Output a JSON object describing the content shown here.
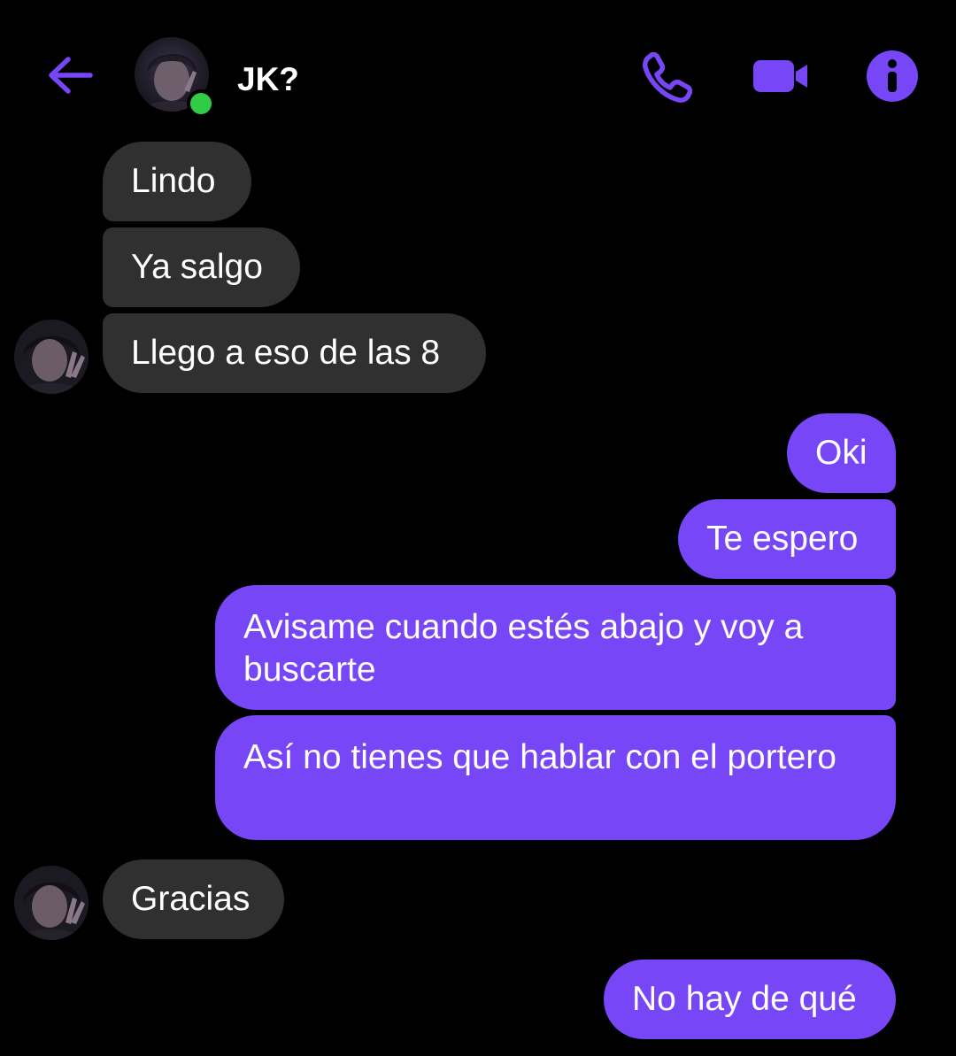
{
  "header": {
    "contact_name": "JK?",
    "online": true,
    "actions": [
      {
        "name": "phone-call",
        "icon": "phone-icon"
      },
      {
        "name": "video-call",
        "icon": "video-camera-icon"
      },
      {
        "name": "conversation-info",
        "icon": "info-icon"
      }
    ]
  },
  "colors": {
    "background": "#000000",
    "accent": "#7646f7",
    "incoming_bubble": "#303030",
    "online_indicator": "#31cc46"
  },
  "messages": [
    {
      "direction": "incoming",
      "text": "Lindo"
    },
    {
      "direction": "incoming",
      "text": "Ya salgo"
    },
    {
      "direction": "incoming",
      "text": "Llego a eso de las 8"
    },
    {
      "direction": "outgoing",
      "text": "Oki"
    },
    {
      "direction": "outgoing",
      "text": "Te espero"
    },
    {
      "direction": "outgoing",
      "text": "Avisame cuando estés abajo y voy a buscarte"
    },
    {
      "direction": "outgoing",
      "text": "Así no tienes que hablar con el portero"
    },
    {
      "direction": "incoming",
      "text": "Gracias"
    },
    {
      "direction": "outgoing",
      "text": "No hay de qué"
    }
  ]
}
